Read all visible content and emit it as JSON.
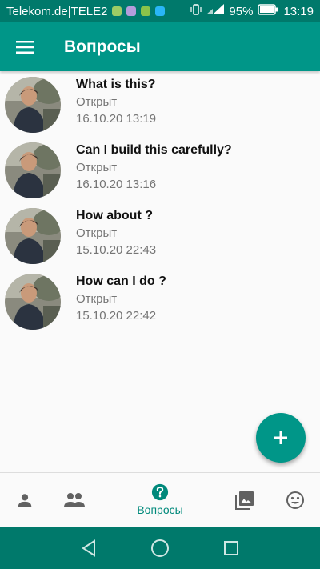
{
  "status_bar": {
    "carrier": "Telekom.de|TELE2",
    "battery": "95%",
    "time": "13:19"
  },
  "app_bar": {
    "title": "Вопросы",
    "menu_icon": "hamburger-menu-icon"
  },
  "questions": [
    {
      "title": "What is this?",
      "status": "Открыт",
      "date": "16.10.20 13:19"
    },
    {
      "title": "Can I build this carefully?",
      "status": "Открыт",
      "date": "16.10.20 13:16"
    },
    {
      "title": "How about ?",
      "status": "Открыт",
      "date": "15.10.20 22:43"
    },
    {
      "title": "How can I do ?",
      "status": "Открыт",
      "date": "15.10.20 22:42"
    }
  ],
  "fab": {
    "icon": "plus-icon"
  },
  "bottom_nav": {
    "items": [
      {
        "icon": "person-icon"
      },
      {
        "icon": "people-icon"
      },
      {
        "icon": "question-icon",
        "label": "Вопросы",
        "active": true
      },
      {
        "icon": "photo-library-icon"
      },
      {
        "icon": "smiley-icon"
      }
    ]
  },
  "colors": {
    "primary": "#009688",
    "primary_dark": "#00796b",
    "active_nav": "#00897b",
    "inactive_icon": "#616161"
  }
}
